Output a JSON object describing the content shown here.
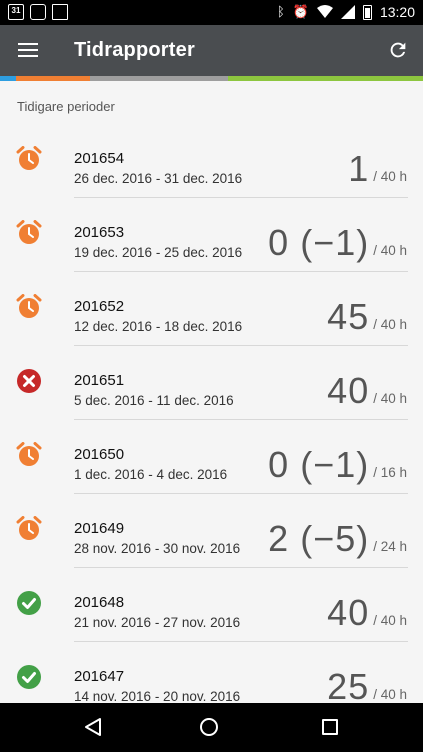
{
  "status_bar": {
    "time": "13:20",
    "calendar_badge": "31",
    "icons": [
      "calendar-icon",
      "gallery-icon",
      "store-icon",
      "bluetooth-icon",
      "alarm-icon",
      "wifi-icon",
      "signal-icon",
      "battery-icon"
    ]
  },
  "app_bar": {
    "title": "Tidrapporter",
    "menu_icon": "menu-icon",
    "refresh_icon": "refresh-icon"
  },
  "colors": {
    "appbar": "#4a4d50",
    "strip": [
      "#2e9ee0",
      "#f07f33",
      "#9e9e9e",
      "#8dc63f"
    ],
    "alarm": "#f07f33",
    "error": "#c62828",
    "ok": "#43a047"
  },
  "section_header": "Tidigare perioder",
  "periods": [
    {
      "week": "201654",
      "dates": "26 dec. 2016 - 31 dec. 2016",
      "hours": "1",
      "target": "/ 40 h",
      "status": "alarm"
    },
    {
      "week": "201653",
      "dates": "19 dec. 2016 - 25 dec. 2016",
      "hours": "0 (−1)",
      "target": "/ 40 h",
      "status": "alarm"
    },
    {
      "week": "201652",
      "dates": "12 dec. 2016 - 18 dec. 2016",
      "hours": "45",
      "target": "/ 40 h",
      "status": "alarm"
    },
    {
      "week": "201651",
      "dates": "5 dec. 2016 - 11 dec. 2016",
      "hours": "40",
      "target": "/ 40 h",
      "status": "error"
    },
    {
      "week": "201650",
      "dates": "1 dec. 2016 - 4 dec. 2016",
      "hours": "0 (−1)",
      "target": "/ 16 h",
      "status": "alarm"
    },
    {
      "week": "201649",
      "dates": "28 nov. 2016 - 30 nov. 2016",
      "hours": "2 (−5)",
      "target": "/ 24 h",
      "status": "alarm"
    },
    {
      "week": "201648",
      "dates": "21 nov. 2016 - 27 nov. 2016",
      "hours": "40",
      "target": "/ 40 h",
      "status": "ok"
    },
    {
      "week": "201647",
      "dates": "14 nov. 2016 - 20 nov. 2016",
      "hours": "25",
      "target": "/ 40 h",
      "status": "ok"
    }
  ],
  "nav_bar": {
    "icons": [
      "back-icon",
      "home-icon",
      "recents-icon"
    ]
  }
}
